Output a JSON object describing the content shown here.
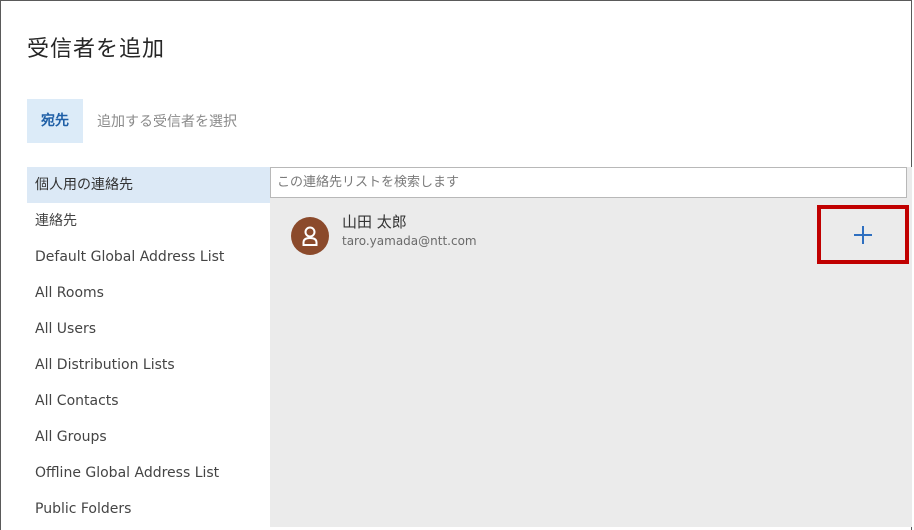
{
  "dialog": {
    "title": "受信者を追加"
  },
  "recipients": {
    "to_label": "宛先",
    "hint": "追加する受信者を選択"
  },
  "address_books": {
    "selected_index": 0,
    "items": [
      {
        "label": "個人用の連絡先"
      },
      {
        "label": "連絡先"
      },
      {
        "label": "Default Global Address List"
      },
      {
        "label": "All Rooms"
      },
      {
        "label": "All Users"
      },
      {
        "label": "All Distribution Lists"
      },
      {
        "label": "All Contacts"
      },
      {
        "label": "All Groups"
      },
      {
        "label": "Offline Global Address List"
      },
      {
        "label": "Public Folders"
      }
    ]
  },
  "search": {
    "placeholder": "この連絡先リストを検索します",
    "value": ""
  },
  "contacts": [
    {
      "name": "山田 太郎",
      "email": "taro.yamada@ntt.com",
      "avatar_color": "#8b4a2b",
      "avatar_icon": "person-icon",
      "add_icon": "plus-icon"
    }
  ],
  "colors": {
    "accent": "#2e6fc0",
    "selected_bg": "#dce9f6",
    "highlight_box": "#c00000",
    "panel_bg": "#ebebeb"
  }
}
